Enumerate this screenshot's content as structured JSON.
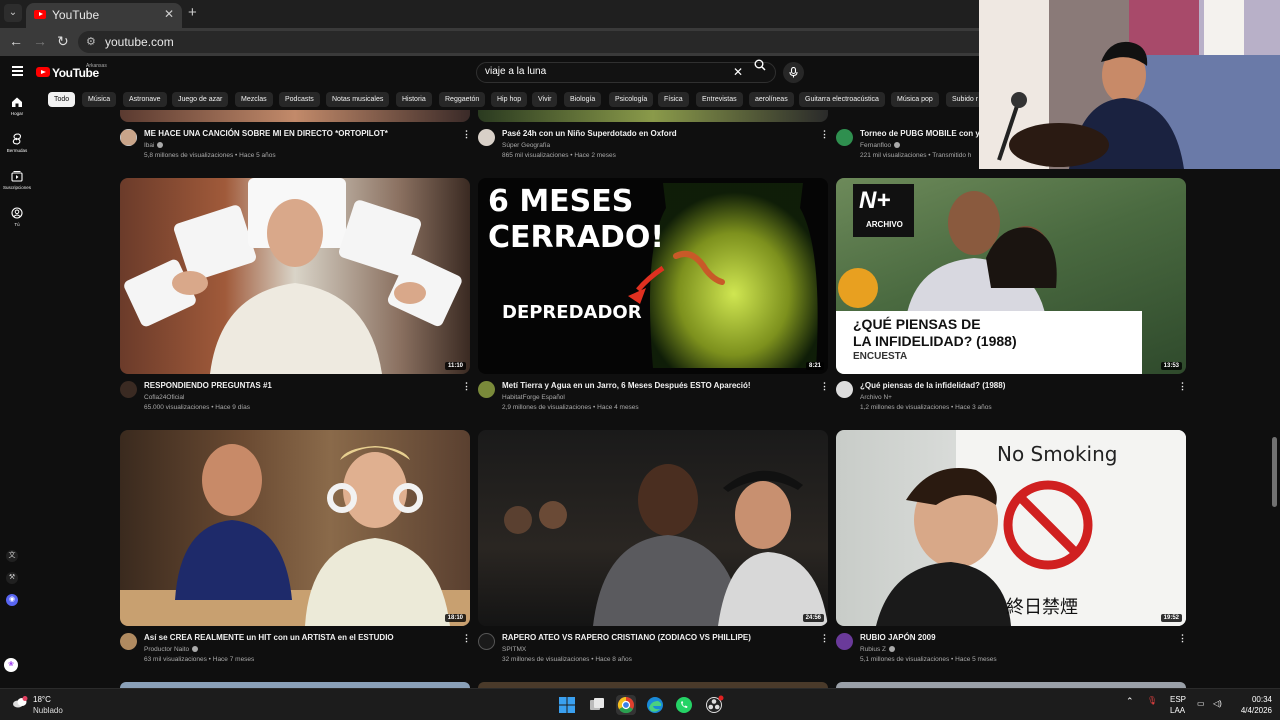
{
  "browser": {
    "tab_title": "YouTube",
    "url": "youtube.com"
  },
  "header": {
    "logo_text": "YouTube",
    "country": "Arkansas",
    "search_query": "viaje a la luna"
  },
  "chips": [
    "Todo",
    "Música",
    "Astronave",
    "Juego de azar",
    "Mezclas",
    "Podcasts",
    "Notas musicales",
    "Historia",
    "Reggaetón",
    "Hip hop",
    "Vivir",
    "Biología",
    "Psicología",
    "Física",
    "Entrevistas",
    "aerolíneas",
    "Guitarra electroacústica",
    "Música pop",
    "Subido r"
  ],
  "rail": [
    {
      "label": "Hogar",
      "icon": "home-icon"
    },
    {
      "label": "Bermudas",
      "icon": "shorts-icon"
    },
    {
      "label": "Suscripciones",
      "icon": "subscriptions-icon"
    },
    {
      "label": "Tú",
      "icon": "you-icon"
    }
  ],
  "videos": {
    "top": [
      {
        "title": "ME HACE UNA CANCIÓN SOBRE MI EN DIRECTO *ORTOPILOT*",
        "channel": "Ibai",
        "meta": "5,8 millones de visualizaciones • Hace 5 años"
      },
      {
        "title": "Pasé 24h con un Niño Superdotado en Oxford",
        "channel": "Súper Geografía",
        "meta": "865 mil visualizaciones • Hace 2 meses"
      },
      {
        "title": "Torneo de PUBG MOBILE con you",
        "channel": "Fernanfloo",
        "meta": "221 mil visualizaciones • Transmitido h"
      }
    ],
    "row1": [
      {
        "title": "RESPONDIENDO PREGUNTAS #1",
        "channel": "Cofla24Oficial",
        "meta": "65.000 visualizaciones • Hace 9 días",
        "duration": "11:10"
      },
      {
        "title": "Metí Tierra y Agua en un Jarro, 6 Meses Después ESTO Apareció!",
        "channel": "HabitatForge Español",
        "meta": "2,9 millones de visualizaciones • Hace 4 meses",
        "duration": "8:21",
        "thumb_text_1": "6 MESES",
        "thumb_text_2": "CERRADO!",
        "thumb_text_3": "DEPREDADOR"
      },
      {
        "title": "¿Qué piensas de la infidelidad? (1988)",
        "channel": "Archivo N+",
        "meta": "1,2 millones de visualizaciones • Hace 3 años",
        "duration": "13:53",
        "thumb_badge": "N+",
        "thumb_badge_sub": "ARCHIVO",
        "thumb_caption_1": "¿QUÉ PIENSAS DE",
        "thumb_caption_2": "LA INFIDELIDAD? (1988)",
        "thumb_caption_3": "ENCUESTA"
      }
    ],
    "row2": [
      {
        "title": "Así se CREA REALMENTE un HIT con un ARTISTA en el ESTUDIO",
        "channel": "Productor Naito",
        "meta": "63 mil visualizaciones • Hace 7 meses",
        "duration": "18:10"
      },
      {
        "title": "RAPERO ATEO VS RAPERO CRISTIANO (ZODIACO VS PHILLIPE)",
        "channel": "SPITMX",
        "meta": "32 millones de visualizaciones • Hace 8 años",
        "duration": "24:56"
      },
      {
        "title": "RUBIO JAPÓN 2009",
        "channel": "Rubius Z",
        "meta": "5,1 millones de visualizaciones • Hace 5 meses",
        "duration": "19:52",
        "thumb_sign": "No Smoking",
        "thumb_kanji": "終日禁煙"
      }
    ]
  },
  "taskbar": {
    "temp": "18°C",
    "weather": "Nublado",
    "lang_1": "ESP",
    "lang_2": "LAA",
    "time": "00:34",
    "date": "4/4/2026"
  },
  "colors": {
    "background": "#0f0f0f",
    "brand_red": "#ff0000",
    "chip_bg": "#272727"
  }
}
